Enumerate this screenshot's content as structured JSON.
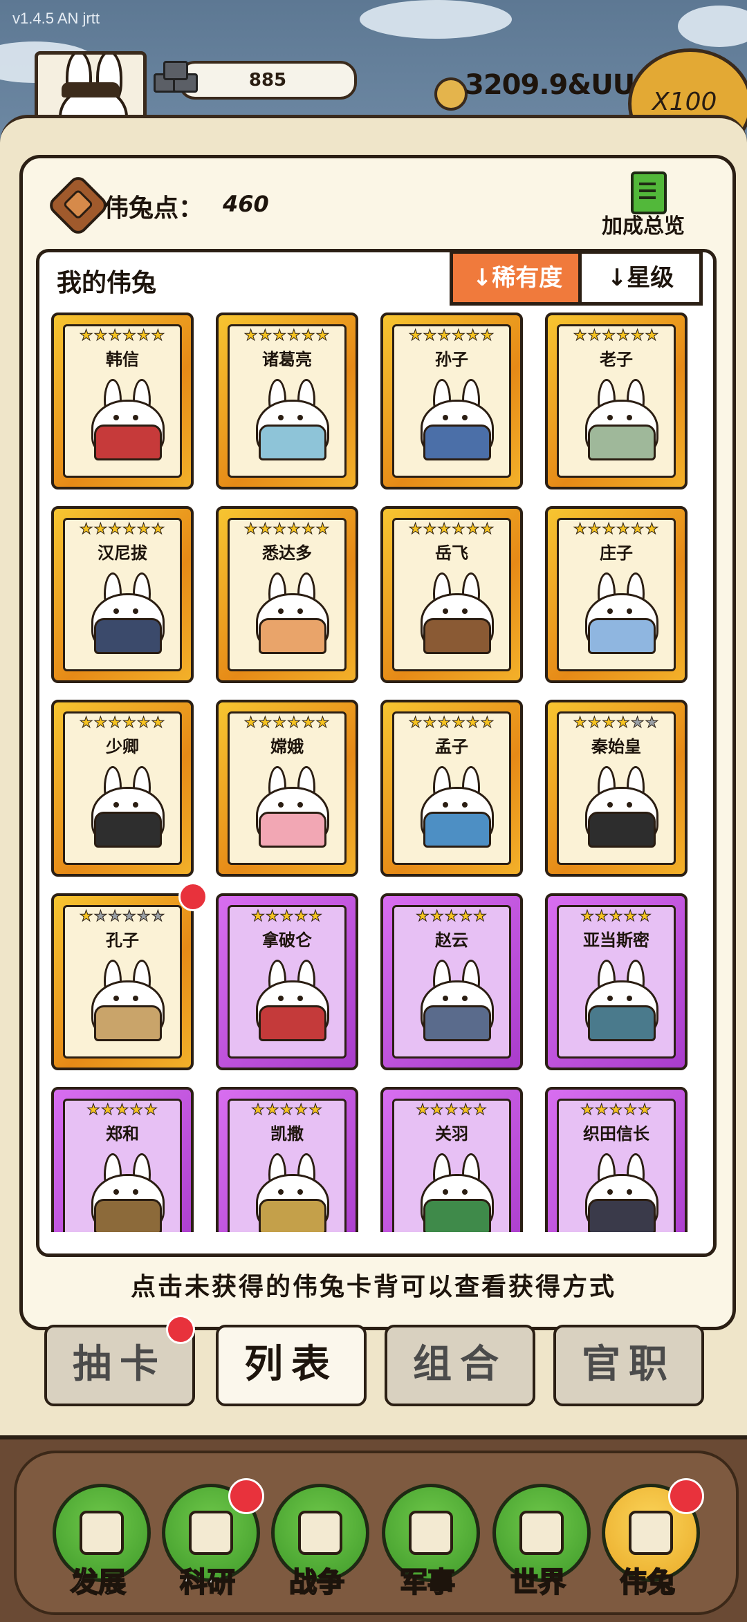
{
  "version": "v1.4.5 AN jrtt",
  "header": {
    "stat_value": "885",
    "coins": "3209.9&UU",
    "multiplier": "X100"
  },
  "points": {
    "label": "伟兔点：",
    "value": "460"
  },
  "bonus_label": "加成总览",
  "list": {
    "title": "我的伟兔",
    "sort_rarity": "稀有度",
    "sort_star": "星级"
  },
  "cards": [
    {
      "name": "韩信",
      "stars": 6,
      "max_stars": 6,
      "tier": "gold",
      "robe": "#c63a3a"
    },
    {
      "name": "诸葛亮",
      "stars": 6,
      "max_stars": 6,
      "tier": "gold",
      "robe": "#8ec4d8"
    },
    {
      "name": "孙子",
      "stars": 6,
      "max_stars": 6,
      "tier": "gold",
      "robe": "#4b6fa8"
    },
    {
      "name": "老子",
      "stars": 6,
      "max_stars": 6,
      "tier": "gold",
      "robe": "#9fb89a"
    },
    {
      "name": "汉尼拔",
      "stars": 6,
      "max_stars": 6,
      "tier": "gold",
      "robe": "#3b4a6b"
    },
    {
      "name": "悉达多",
      "stars": 6,
      "max_stars": 6,
      "tier": "gold",
      "robe": "#e9a46a"
    },
    {
      "name": "岳飞",
      "stars": 6,
      "max_stars": 6,
      "tier": "gold",
      "robe": "#8a5a34"
    },
    {
      "name": "庄子",
      "stars": 6,
      "max_stars": 6,
      "tier": "gold",
      "robe": "#8fb6e0"
    },
    {
      "name": "少卿",
      "stars": 6,
      "max_stars": 6,
      "tier": "gold",
      "robe": "#2e2e2e"
    },
    {
      "name": "嫦娥",
      "stars": 6,
      "max_stars": 6,
      "tier": "gold",
      "robe": "#f2a7b4"
    },
    {
      "name": "孟子",
      "stars": 6,
      "max_stars": 6,
      "tier": "gold",
      "robe": "#4d8fc4"
    },
    {
      "name": "秦始皇",
      "stars": 4,
      "max_stars": 6,
      "tier": "gold",
      "robe": "#2d2d2d"
    },
    {
      "name": "孔子",
      "stars": 1,
      "max_stars": 6,
      "tier": "gold",
      "robe": "#c9a46a",
      "badge": true
    },
    {
      "name": "拿破仑",
      "stars": 5,
      "max_stars": 5,
      "tier": "purple",
      "robe": "#c43a3a"
    },
    {
      "name": "赵云",
      "stars": 5,
      "max_stars": 5,
      "tier": "purple",
      "robe": "#5a6b8c"
    },
    {
      "name": "亚当斯密",
      "stars": 5,
      "max_stars": 5,
      "tier": "purple",
      "robe": "#4a7a8c"
    },
    {
      "name": "郑和",
      "stars": 5,
      "max_stars": 5,
      "tier": "purple",
      "robe": "#8c6a3a"
    },
    {
      "name": "凯撒",
      "stars": 5,
      "max_stars": 5,
      "tier": "purple",
      "robe": "#c4a04a"
    },
    {
      "name": "关羽",
      "stars": 5,
      "max_stars": 5,
      "tier": "purple",
      "robe": "#3f8a4a"
    },
    {
      "name": "织田信长",
      "stars": 5,
      "max_stars": 5,
      "tier": "purple",
      "robe": "#3a3a4a"
    }
  ],
  "hint": "点击未获得的伟兔卡背可以查看获得方式",
  "tabs": [
    {
      "label": "抽卡",
      "badge": true
    },
    {
      "label": "列表",
      "active": true
    },
    {
      "label": "组合"
    },
    {
      "label": "官职"
    }
  ],
  "nav": [
    {
      "label": "发展",
      "icon": "arrow-up-icon",
      "color": "green"
    },
    {
      "label": "科研",
      "icon": "flask-icon",
      "color": "green",
      "badge": true
    },
    {
      "label": "战争",
      "icon": "crossed-swords-icon",
      "color": "green"
    },
    {
      "label": "军事",
      "icon": "helmet-icon",
      "color": "green"
    },
    {
      "label": "世界",
      "icon": "globe-icon",
      "color": "green"
    },
    {
      "label": "伟兔",
      "icon": "bunny-portrait-icon",
      "color": "yellow",
      "badge": true
    }
  ]
}
